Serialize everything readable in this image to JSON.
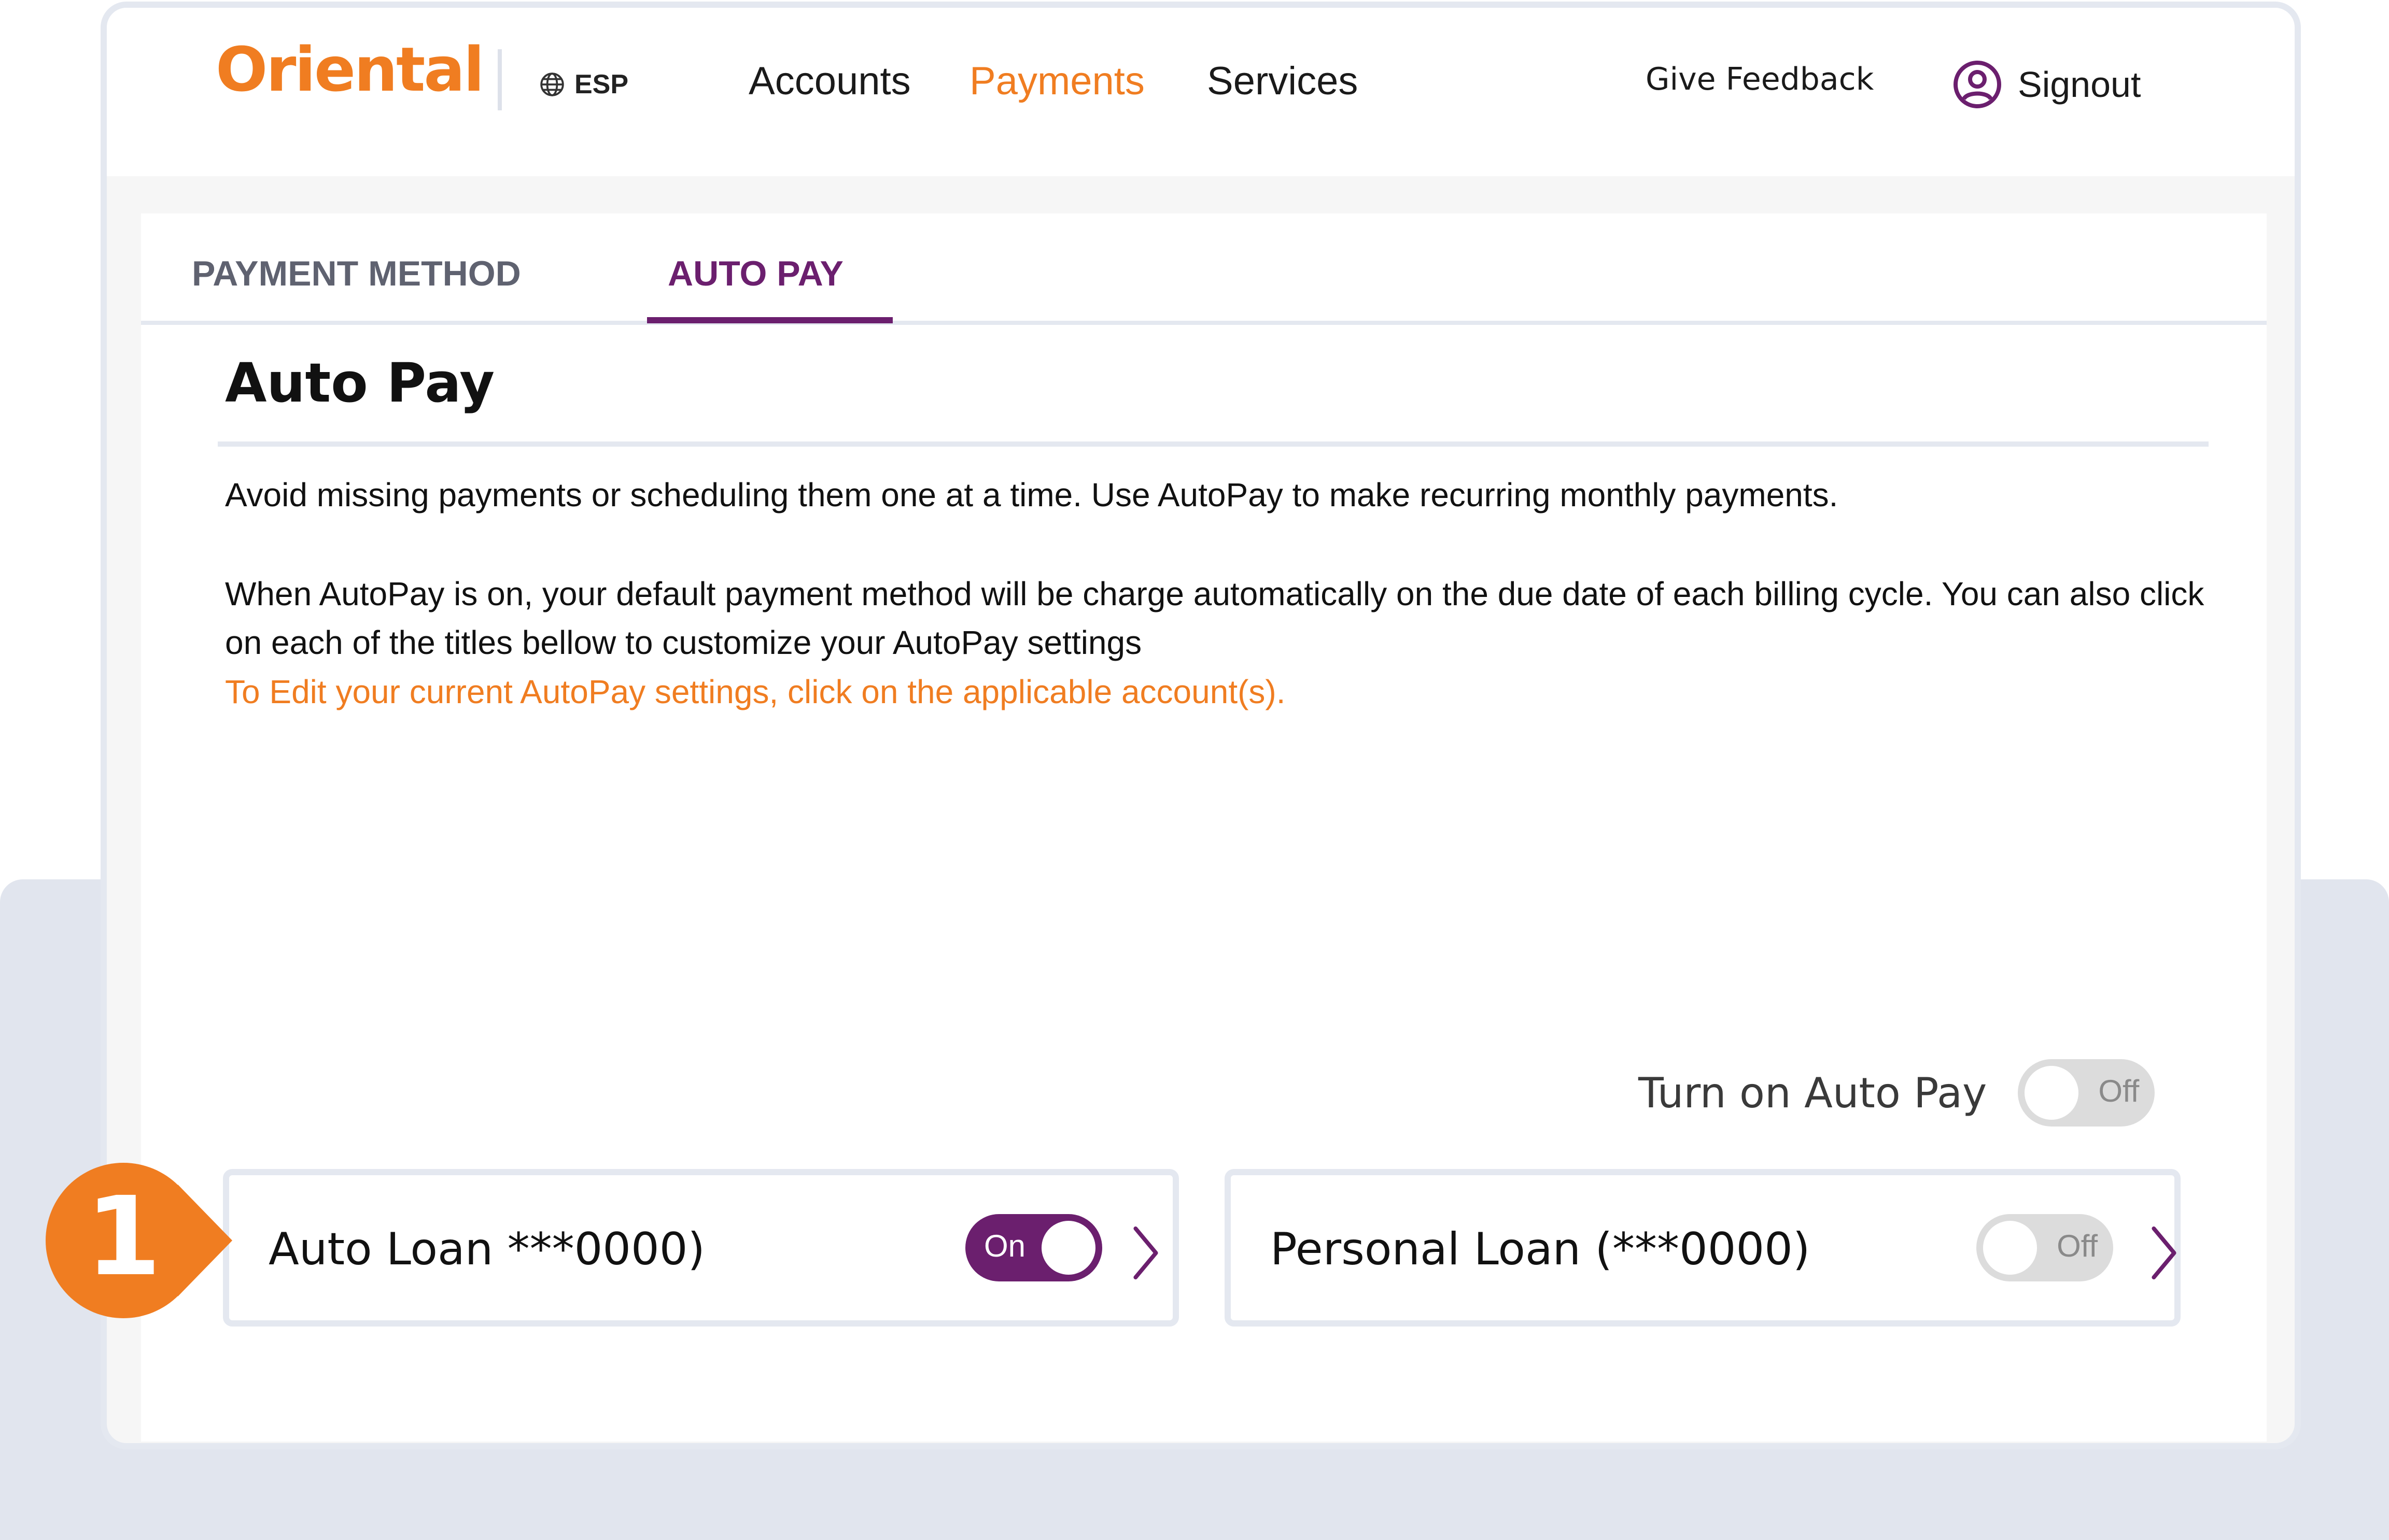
{
  "brand": {
    "logo_text": "Oriental",
    "accent_color": "#f07d21",
    "primary_color": "#6b1f6e"
  },
  "header": {
    "language": {
      "icon": "globe-icon",
      "label": "ESP"
    },
    "nav": [
      {
        "label": "Accounts",
        "active": false
      },
      {
        "label": "Payments",
        "active": true
      },
      {
        "label": "Services",
        "active": false
      }
    ],
    "feedback_label": "Give Feedback",
    "signout": {
      "icon": "user-circle-icon",
      "label": "Signout"
    }
  },
  "tabs": [
    {
      "label": "PAYMENT METHOD",
      "active": false
    },
    {
      "label": "AUTO PAY",
      "active": true
    }
  ],
  "autopay": {
    "title": "Auto Pay",
    "intro": "Avoid missing payments or scheduling them one at a time. Use AutoPay to make recurring monthly payments.",
    "details": "When AutoPay is on, your default payment method will be charge automatically on the due date of each billing cycle. You can also click on each of the titles bellow to customize your AutoPay settings",
    "edit_hint": "To Edit your current AutoPay settings, click on the applicable account(s).",
    "master_toggle": {
      "label": "Turn on Auto Pay",
      "state_label": "Off",
      "on": false
    },
    "accounts": [
      {
        "name": "Auto Loan ***0000)",
        "state_label": "On",
        "on": true,
        "icon": "chevron-right-icon"
      },
      {
        "name": "Personal Loan (***0000)",
        "state_label": "Off",
        "on": false,
        "icon": "chevron-right-icon"
      }
    ]
  },
  "callout": {
    "number": "1",
    "color": "#f07d21"
  }
}
